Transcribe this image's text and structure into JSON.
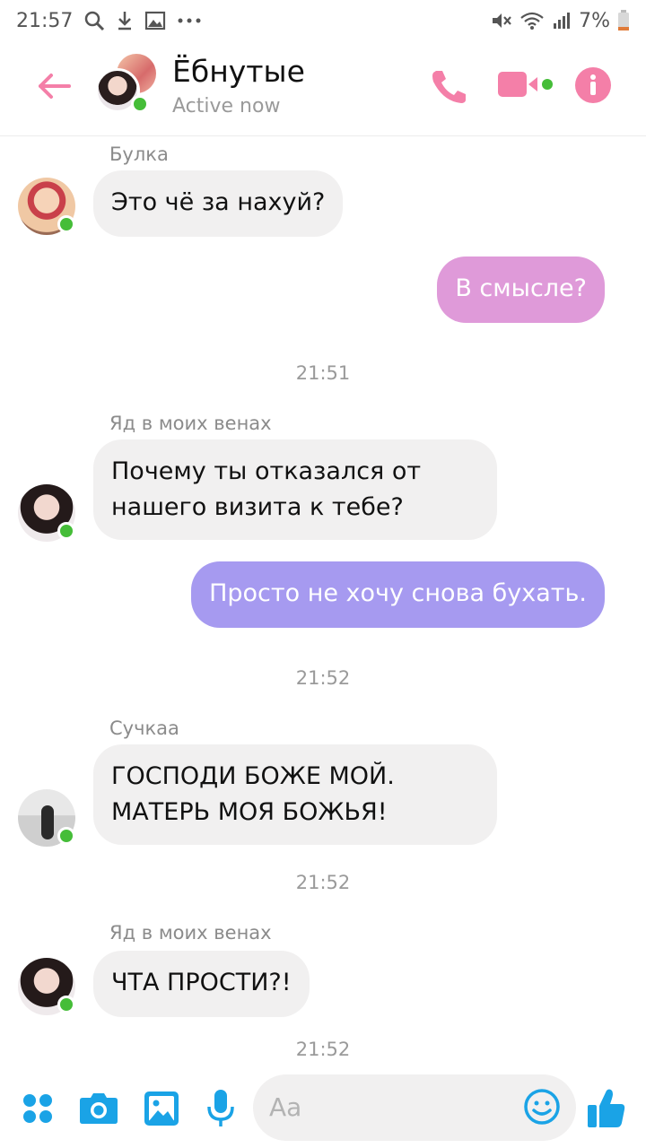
{
  "status_bar": {
    "time": "21:57",
    "battery": "7%"
  },
  "header": {
    "title": "Ёбнутые",
    "status": "Active now"
  },
  "messages": {
    "m1": {
      "sender": "Булка",
      "text": "Это чё за нахуй?"
    },
    "m2": {
      "text": "В смысле?"
    },
    "t1": "21:51",
    "m3": {
      "sender": "Яд в моих венах",
      "line1": "Почему ты отказался от",
      "line2": "нашего визита к тебе?"
    },
    "m4": {
      "text": "Просто не хочу снова бухать."
    },
    "t2": "21:52",
    "m5": {
      "sender": "Сучкаа",
      "line1": "ГОСПОДИ БОЖЕ МОЙ.",
      "line2": "МАТЕРЬ МОЯ БОЖЬЯ!"
    },
    "t3": "21:52",
    "m6": {
      "sender": "Яд в моих венах",
      "text": "ЧТА ПРОСТИ?!"
    },
    "t4": "21:52"
  },
  "composer": {
    "placeholder": "Aa"
  },
  "colors": {
    "accent": "#1aa3e6",
    "header_icons": "#f47fa8",
    "online": "#45bd38",
    "bubble_pink": "#df9ad9",
    "bubble_purple": "#a69af0",
    "bubble_incoming": "#f1f0f0"
  },
  "icons": {
    "status_left": [
      "search-icon",
      "download-icon",
      "image-icon",
      "more-icon"
    ],
    "status_right": [
      "mute-icon",
      "wifi-icon",
      "signal-icon",
      "battery-icon"
    ],
    "header": [
      "back-arrow-icon",
      "phone-icon",
      "video-icon",
      "info-icon"
    ],
    "composer": [
      "apps-icon",
      "camera-icon",
      "gallery-icon",
      "mic-icon",
      "emoji-icon",
      "thumbs-up-icon"
    ]
  }
}
